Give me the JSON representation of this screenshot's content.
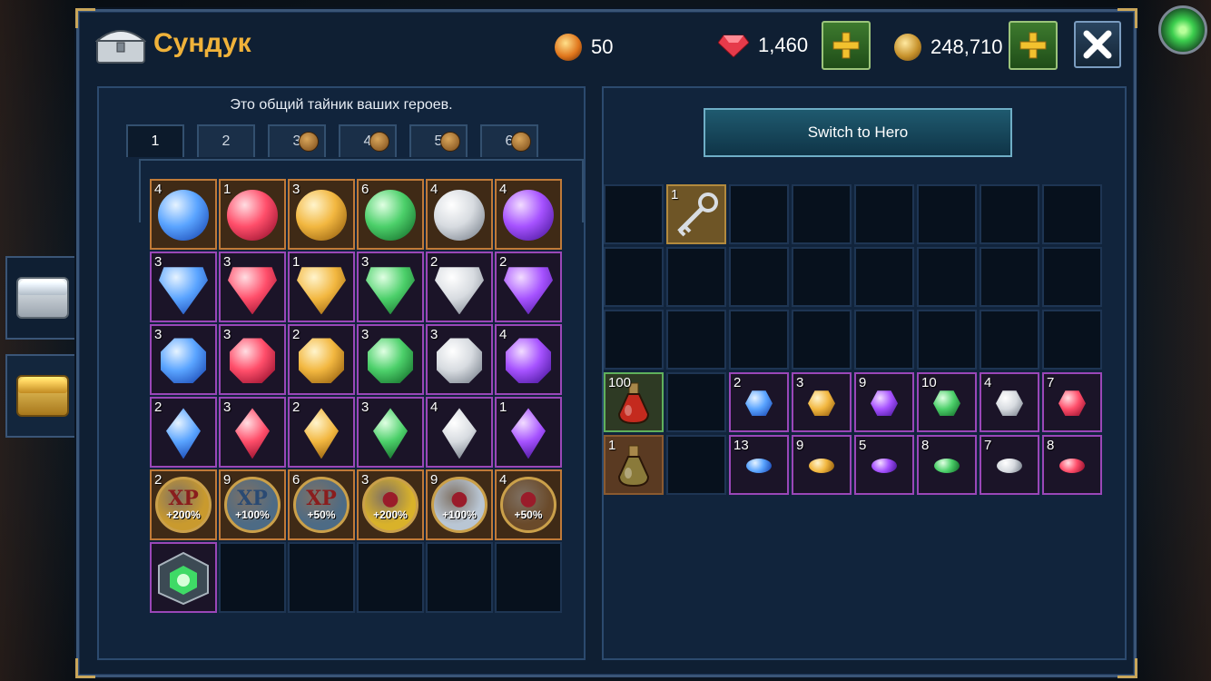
{
  "header": {
    "title": "Сундук",
    "energy": "50",
    "gems": "1,460",
    "gold": "248,710"
  },
  "left": {
    "description": "Это общий тайник ваших героев.",
    "tabs": [
      {
        "label": "1",
        "locked": false
      },
      {
        "label": "2",
        "locked": false
      },
      {
        "label": "3",
        "locked": true
      },
      {
        "label": "4",
        "locked": true
      },
      {
        "label": "5",
        "locked": true
      },
      {
        "label": "6",
        "locked": true
      }
    ],
    "grid": [
      {
        "c": "4",
        "shape": "g-round",
        "color": "blue",
        "frame": "orange"
      },
      {
        "c": "1",
        "shape": "g-round",
        "color": "red",
        "frame": "orange"
      },
      {
        "c": "3",
        "shape": "g-round",
        "color": "yellow",
        "frame": "orange"
      },
      {
        "c": "6",
        "shape": "g-round",
        "color": "emerald",
        "frame": "orange"
      },
      {
        "c": "4",
        "shape": "g-round",
        "color": "white",
        "frame": "orange"
      },
      {
        "c": "4",
        "shape": "g-round",
        "color": "violet",
        "frame": "orange"
      },
      {
        "c": "3",
        "shape": "g-shield",
        "color": "blue",
        "frame": "purple"
      },
      {
        "c": "3",
        "shape": "g-shield",
        "color": "red",
        "frame": "purple"
      },
      {
        "c": "1",
        "shape": "g-shield",
        "color": "yellow",
        "frame": "purple"
      },
      {
        "c": "3",
        "shape": "g-shield",
        "color": "emerald",
        "frame": "purple"
      },
      {
        "c": "2",
        "shape": "g-shield",
        "color": "white",
        "frame": "purple"
      },
      {
        "c": "2",
        "shape": "g-shield",
        "color": "violet",
        "frame": "purple"
      },
      {
        "c": "3",
        "shape": "g-oct",
        "color": "blue",
        "frame": "purple"
      },
      {
        "c": "3",
        "shape": "g-oct",
        "color": "red",
        "frame": "purple"
      },
      {
        "c": "2",
        "shape": "g-oct",
        "color": "yellow",
        "frame": "purple"
      },
      {
        "c": "3",
        "shape": "g-oct",
        "color": "emerald",
        "frame": "purple"
      },
      {
        "c": "3",
        "shape": "g-oct",
        "color": "white",
        "frame": "purple"
      },
      {
        "c": "4",
        "shape": "g-oct",
        "color": "violet",
        "frame": "purple"
      },
      {
        "c": "2",
        "shape": "g-drop",
        "color": "blue",
        "frame": "purple"
      },
      {
        "c": "3",
        "shape": "g-drop",
        "color": "red",
        "frame": "purple"
      },
      {
        "c": "2",
        "shape": "g-drop",
        "color": "yellow",
        "frame": "purple"
      },
      {
        "c": "3",
        "shape": "g-drop",
        "color": "emerald",
        "frame": "purple"
      },
      {
        "c": "4",
        "shape": "g-drop",
        "color": "white",
        "frame": "purple"
      },
      {
        "c": "1",
        "shape": "g-drop",
        "color": "violet",
        "frame": "purple"
      },
      {
        "c": "2",
        "xp": "XP",
        "pct": "+200%",
        "bg": "#c99a2e",
        "xpc": "#8a1d1d",
        "frame": "orange"
      },
      {
        "c": "9",
        "xp": "XP",
        "pct": "+100%",
        "bg": "#4d6b85",
        "xpc": "#2a4a73",
        "frame": "orange"
      },
      {
        "c": "6",
        "xp": "XP",
        "pct": "+50%",
        "bg": "#4d6b85",
        "xpc": "#8a1d1d",
        "frame": "orange"
      },
      {
        "c": "3",
        "xp": "●",
        "pct": "+200%",
        "bg": "#d9b22a",
        "xpc": "#9a1c2a",
        "frame": "orange"
      },
      {
        "c": "9",
        "xp": "●",
        "pct": "+100%",
        "bg": "#b9c6d4",
        "xpc": "#9a1c2a",
        "frame": "orange"
      },
      {
        "c": "4",
        "xp": "●",
        "pct": "+50%",
        "bg": "#6a4a2a",
        "xpc": "#9a1c2a",
        "frame": "orange"
      },
      {
        "c": "",
        "special": "cube",
        "frame": "purple"
      },
      {
        "c": "",
        "empty": true
      },
      {
        "c": "",
        "empty": true
      },
      {
        "c": "",
        "empty": true
      },
      {
        "c": "",
        "empty": true
      },
      {
        "c": "",
        "empty": true
      }
    ]
  },
  "right": {
    "switch_label": "Switch to Hero",
    "grid": [
      {
        "empty": true
      },
      {
        "c": "1",
        "special": "key",
        "frame": "gold"
      },
      {
        "empty": true
      },
      {
        "empty": true
      },
      {
        "empty": true
      },
      {
        "empty": true
      },
      {
        "empty": true
      },
      {
        "empty": true
      },
      {
        "empty": true
      },
      {
        "empty": true
      },
      {
        "empty": true
      },
      {
        "empty": true
      },
      {
        "empty": true
      },
      {
        "empty": true
      },
      {
        "empty": true
      },
      {
        "empty": true
      },
      {
        "empty": true
      },
      {
        "empty": true
      },
      {
        "empty": true
      },
      {
        "empty": true
      },
      {
        "empty": true
      },
      {
        "empty": true
      },
      {
        "empty": true
      },
      {
        "empty": true
      },
      {
        "c": "100",
        "special": "potion-red",
        "frame": "green"
      },
      {
        "empty": true
      },
      {
        "c": "2",
        "shape": "g-small",
        "color": "blue",
        "frame": "purple"
      },
      {
        "c": "3",
        "shape": "g-small",
        "color": "yellow",
        "frame": "purple"
      },
      {
        "c": "9",
        "shape": "g-small",
        "color": "violet",
        "frame": "purple"
      },
      {
        "c": "10",
        "shape": "g-small",
        "color": "emerald",
        "frame": "purple"
      },
      {
        "c": "4",
        "shape": "g-small",
        "color": "white",
        "frame": "purple"
      },
      {
        "c": "7",
        "shape": "g-small",
        "color": "red",
        "frame": "purple"
      },
      {
        "c": "1",
        "special": "potion-yellow",
        "frame": "potion"
      },
      {
        "empty": true
      },
      {
        "c": "13",
        "shape": "g-chip",
        "color": "blue",
        "frame": "purple"
      },
      {
        "c": "9",
        "shape": "g-chip",
        "color": "yellow",
        "frame": "purple"
      },
      {
        "c": "5",
        "shape": "g-chip",
        "color": "violet",
        "frame": "purple"
      },
      {
        "c": "8",
        "shape": "g-chip",
        "color": "emerald",
        "frame": "purple"
      },
      {
        "c": "7",
        "shape": "g-chip",
        "color": "white",
        "frame": "purple"
      },
      {
        "c": "8",
        "shape": "g-chip",
        "color": "red",
        "frame": "purple"
      }
    ]
  },
  "colors": {
    "accent_title": "#f0b23a",
    "panel_bg": "#11243c",
    "plus_green": "#3d7a2e"
  },
  "icons": {
    "header": "chest-icon",
    "energy": "energy-orb-icon",
    "gems": "ruby-icon",
    "gold": "gold-coin-icon",
    "close": "close-icon",
    "plus": "plus-icon",
    "lock": "lock-icon"
  }
}
